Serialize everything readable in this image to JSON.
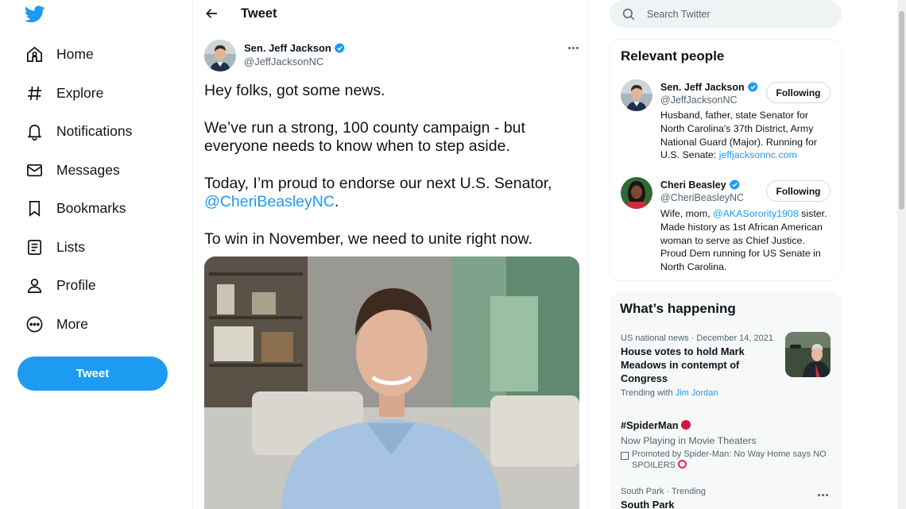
{
  "colors": {
    "accent": "#1d9bf0",
    "text": "#0f1419",
    "secondary": "#536471",
    "border": "#eff3f4"
  },
  "nav": {
    "logo_icon": "twitter-bird-icon",
    "items": [
      {
        "label": "Home",
        "icon": "home-icon"
      },
      {
        "label": "Explore",
        "icon": "hashtag-icon"
      },
      {
        "label": "Notifications",
        "icon": "bell-icon"
      },
      {
        "label": "Messages",
        "icon": "envelope-icon"
      },
      {
        "label": "Bookmarks",
        "icon": "bookmark-icon"
      },
      {
        "label": "Lists",
        "icon": "list-icon"
      },
      {
        "label": "Profile",
        "icon": "person-icon"
      },
      {
        "label": "More",
        "icon": "more-circle-icon"
      }
    ],
    "tweet_button": "Tweet"
  },
  "header": {
    "title": "Tweet",
    "back_icon": "arrow-left-icon"
  },
  "tweet": {
    "author_name": "Sen. Jeff Jackson",
    "author_handle": "@JeffJacksonNC",
    "line1": "Hey folks, got some news.",
    "line2": "We’ve run a strong, 100 county campaign - but",
    "line3": "everyone needs to know when to step aside.",
    "line4": "Today, I’m proud to endorse our next U.S. Senator,",
    "mention": "@CheriBeasleyNC",
    "mention_suffix": ".",
    "line6": "To win in November, we need to unite right now."
  },
  "search": {
    "placeholder": "Search Twitter"
  },
  "relevant": {
    "title": "Relevant people",
    "people": [
      {
        "name": "Sen. Jeff Jackson",
        "handle": "@JeffJacksonNC",
        "follow_label": "Following",
        "bio1": "Husband, father, state Senator for",
        "bio2": "North Carolina's 37th District, Army",
        "bio3": "National Guard (Major). Running for",
        "bio4_prefix": "U.S. Senate: ",
        "bio4_link": "jeffjacksonnc.com"
      },
      {
        "name": "Cheri Beasley",
        "handle": "@CheriBeasleyNC",
        "follow_label": "Following",
        "bio1_prefix": "Wife, mom, ",
        "bio1_link": "@AKASorority1908",
        "bio1_suffix": " sister.",
        "bio2": "Made history as 1st African American",
        "bio3": "woman to serve as Chief Justice.",
        "bio4": "Proud Dem running for US Senate in",
        "bio5": "North Carolina."
      }
    ]
  },
  "happening": {
    "title": "What’s happening",
    "trends": [
      {
        "meta": "US national news · December 14, 2021",
        "title1": "House votes to hold Mark",
        "title2": "Meadows in contempt of",
        "title3": "Congress",
        "sub_prefix": "Trending with ",
        "sub_link": "Jim Jordan"
      },
      {
        "title": "#SpiderMan",
        "sub": "Now Playing in Movie Theaters",
        "promo1": "Promoted by Spider-Man: No Way Home says NO",
        "promo2": "SPOILERS",
        "promo_icon": "promoted-icon"
      },
      {
        "meta": "South Park · Trending",
        "title": "South Park"
      }
    ]
  }
}
